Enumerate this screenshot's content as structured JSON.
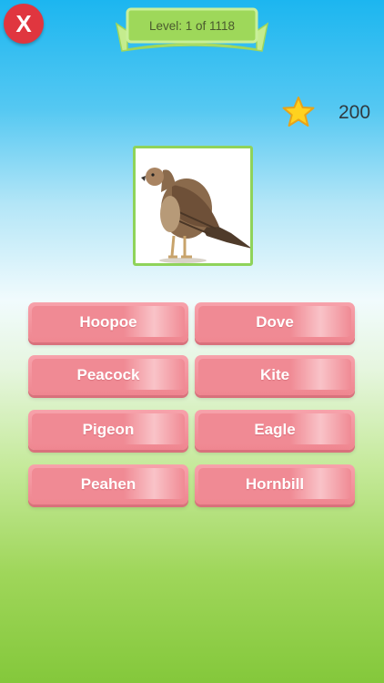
{
  "close_button": {
    "label": "X",
    "color": "#e0363f"
  },
  "level": {
    "text": "Level: 1 of 1118"
  },
  "score": {
    "value": "200",
    "icon": "star-icon"
  },
  "question_image": {
    "subject": "bird-photo"
  },
  "answers": [
    {
      "label": "Hoopoe"
    },
    {
      "label": "Dove"
    },
    {
      "label": "Peacock"
    },
    {
      "label": "Kite"
    },
    {
      "label": "Pigeon"
    },
    {
      "label": "Eagle"
    },
    {
      "label": "Peahen"
    },
    {
      "label": "Hornbill"
    }
  ],
  "colors": {
    "answer_button": "#f08a94",
    "banner": "#9ed85a",
    "card_border": "#8fd35a"
  }
}
